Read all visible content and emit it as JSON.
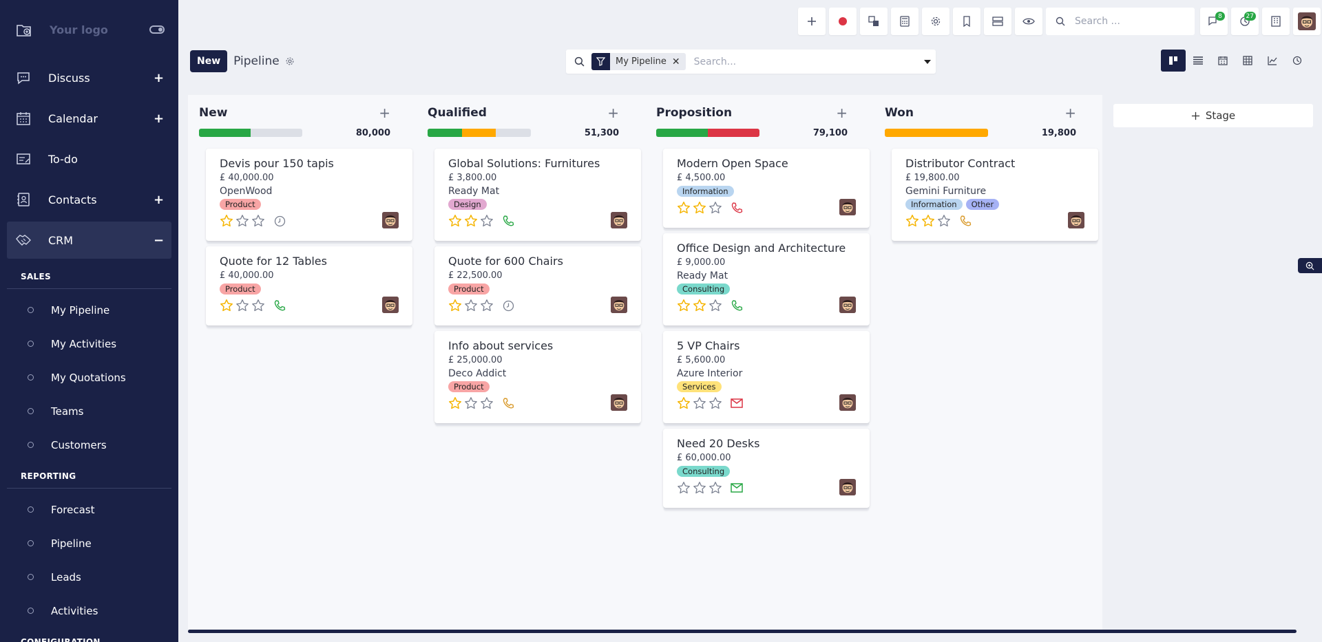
{
  "colors": {
    "sidebar_bg": "#1a2146",
    "accent": "#1a2146",
    "success": "#28a745",
    "warning": "#ffa800",
    "danger": "#dc3545",
    "star": "#f5b400"
  },
  "sidebar": {
    "logo_text": "Your logo",
    "items": [
      {
        "name": "discuss",
        "icon": "chat-icon",
        "label": "Discuss",
        "action": "+"
      },
      {
        "name": "calendar",
        "icon": "calendar-icon",
        "label": "Calendar",
        "action": "+"
      },
      {
        "name": "todo",
        "icon": "note-icon",
        "label": "To-do",
        "action": ""
      },
      {
        "name": "contacts",
        "icon": "contact-card-icon",
        "label": "Contacts",
        "action": "+"
      },
      {
        "name": "crm",
        "icon": "handshake-icon",
        "label": "CRM",
        "action": "−"
      }
    ],
    "sales_section": "SALES",
    "sales_items": [
      "My Pipeline",
      "My Activities",
      "My Quotations",
      "Teams",
      "Customers"
    ],
    "reporting_section": "REPORTING",
    "reporting_items": [
      "Forecast",
      "Pipeline",
      "Leads",
      "Activities"
    ],
    "configuration_section": "CONFIGURATION"
  },
  "topbar": {
    "search_placeholder": "Search ...",
    "messages_badge": "8",
    "activities_badge": "27"
  },
  "control_panel": {
    "new_label": "New",
    "title": "Pipeline",
    "facet_label": "My Pipeline",
    "search_placeholder": "Search..."
  },
  "stage_button_label": "Stage",
  "chart_data": {
    "type": "table",
    "columns": [
      {
        "title": "New",
        "total": "80,000",
        "progress": [
          {
            "color": "#28a745",
            "fraction": 0.5
          }
        ],
        "cards": [
          {
            "title": "Devis pour 150 tapis",
            "revenue": "£ 40,000.00",
            "partner": "OpenWood",
            "tags": [
              {
                "label": "Product",
                "color": "#f8a5a5"
              }
            ],
            "stars": 1,
            "activity": "clock",
            "activity_color": "#7a8090"
          },
          {
            "title": "Quote for 12 Tables",
            "revenue": "£ 40,000.00",
            "partner": "",
            "tags": [
              {
                "label": "Product",
                "color": "#f8a5a5"
              }
            ],
            "stars": 1,
            "activity": "phone",
            "activity_color": "#28a745"
          }
        ]
      },
      {
        "title": "Qualified",
        "total": "51,300",
        "progress": [
          {
            "color": "#28a745",
            "fraction": 0.33
          },
          {
            "color": "#ffa800",
            "fraction": 0.33
          }
        ],
        "cards": [
          {
            "title": "Global Solutions: Furnitures",
            "revenue": "£ 3,800.00",
            "partner": "Ready Mat",
            "tags": [
              {
                "label": "Design",
                "color": "#e2a8d0"
              }
            ],
            "stars": 2,
            "activity": "phone",
            "activity_color": "#28a745"
          },
          {
            "title": "Quote for 600 Chairs",
            "revenue": "£ 22,500.00",
            "partner": "",
            "tags": [
              {
                "label": "Product",
                "color": "#f8a5a5"
              }
            ],
            "stars": 1,
            "activity": "clock",
            "activity_color": "#7a8090"
          },
          {
            "title": "Info about services",
            "revenue": "£ 25,000.00",
            "partner": "Deco Addict",
            "tags": [
              {
                "label": "Product",
                "color": "#f8a5a5"
              }
            ],
            "stars": 1,
            "activity": "phone",
            "activity_color": "#d99a2b"
          }
        ]
      },
      {
        "title": "Proposition",
        "total": "79,100",
        "progress": [
          {
            "color": "#28a745",
            "fraction": 0.5
          },
          {
            "color": "#dc3545",
            "fraction": 0.5
          }
        ],
        "cards": [
          {
            "title": "Modern Open Space",
            "revenue": "£ 4,500.00",
            "partner": "",
            "tags": [
              {
                "label": "Information",
                "color": "#b9d5f0"
              }
            ],
            "stars": 2,
            "activity": "phone",
            "activity_color": "#dc3545"
          },
          {
            "title": "Office Design and Architecture",
            "revenue": "£ 9,000.00",
            "partner": "Ready Mat",
            "tags": [
              {
                "label": "Consulting",
                "color": "#7ad9cc"
              }
            ],
            "stars": 2,
            "activity": "phone",
            "activity_color": "#28a745"
          },
          {
            "title": "5 VP Chairs",
            "revenue": "£ 5,600.00",
            "partner": "Azure Interior",
            "tags": [
              {
                "label": "Services",
                "color": "#ffe27a"
              }
            ],
            "stars": 1,
            "activity": "envelope",
            "activity_color": "#dc3545"
          },
          {
            "title": "Need 20 Desks",
            "revenue": "£ 60,000.00",
            "partner": "",
            "tags": [
              {
                "label": "Consulting",
                "color": "#7ad9cc"
              }
            ],
            "stars": 0,
            "activity": "envelope",
            "activity_color": "#28a745"
          }
        ]
      },
      {
        "title": "Won",
        "total": "19,800",
        "progress": [
          {
            "color": "#ffa800",
            "fraction": 1.0
          }
        ],
        "cards": [
          {
            "title": "Distributor Contract",
            "revenue": "£ 19,800.00",
            "partner": "Gemini Furniture",
            "tags": [
              {
                "label": "Information",
                "color": "#b9d5f0"
              },
              {
                "label": "Other",
                "color": "#a6b2f5"
              }
            ],
            "stars": 2,
            "activity": "phone",
            "activity_color": "#d99a2b"
          }
        ]
      }
    ]
  }
}
